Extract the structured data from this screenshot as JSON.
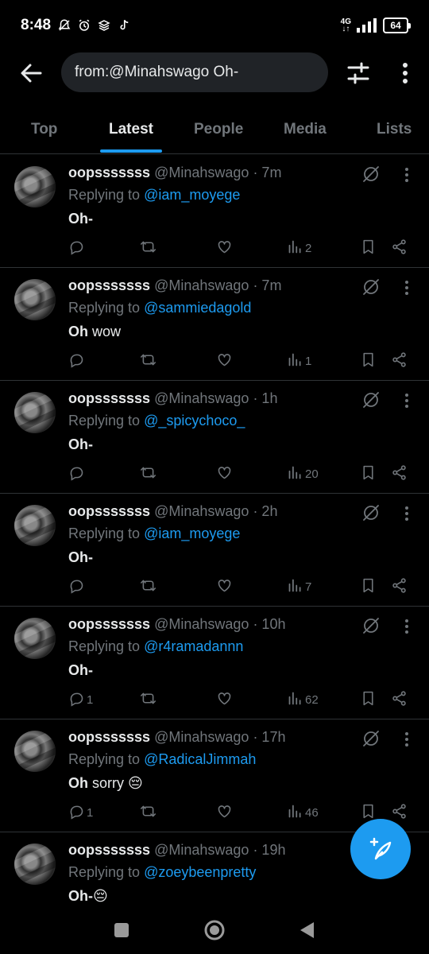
{
  "status": {
    "time": "8:48",
    "network": "4G",
    "battery": "64"
  },
  "search": {
    "query": "from:@Minahswago Oh-"
  },
  "tabs": [
    {
      "label": "Top"
    },
    {
      "label": "Latest"
    },
    {
      "label": "People"
    },
    {
      "label": "Media"
    },
    {
      "label": "Lists"
    }
  ],
  "tweets": [
    {
      "name": "oopsssssss",
      "handle": "@Minahswago",
      "time": "· 7m",
      "replying_prefix": "Replying to",
      "replying_to": "@iam_moyege",
      "text_bold": "Oh-",
      "text_rest": "",
      "replies": "",
      "views": "2"
    },
    {
      "name": "oopsssssss",
      "handle": "@Minahswago",
      "time": "· 7m",
      "replying_prefix": "Replying to",
      "replying_to": "@sammiedagold",
      "text_bold": "Oh",
      "text_rest": " wow",
      "replies": "",
      "views": "1"
    },
    {
      "name": "oopsssssss",
      "handle": "@Minahswago",
      "time": "· 1h",
      "replying_prefix": "Replying to",
      "replying_to": "@_spicychoco_",
      "text_bold": "Oh-",
      "text_rest": "",
      "replies": "",
      "views": "20"
    },
    {
      "name": "oopsssssss",
      "handle": "@Minahswago",
      "time": "· 2h",
      "replying_prefix": "Replying to",
      "replying_to": "@iam_moyege",
      "text_bold": "Oh-",
      "text_rest": "",
      "replies": "",
      "views": "7"
    },
    {
      "name": "oopsssssss",
      "handle": "@Minahswago",
      "time": "· 10h",
      "replying_prefix": "Replying to",
      "replying_to": "@r4ramadannn",
      "text_bold": "Oh-",
      "text_rest": "",
      "replies": "1",
      "views": "62"
    },
    {
      "name": "oopsssssss",
      "handle": "@Minahswago",
      "time": "· 17h",
      "replying_prefix": "Replying to",
      "replying_to": "@RadicalJimmah",
      "text_bold": "Oh",
      "text_rest": " sorry 😔",
      "replies": "1",
      "views": "46"
    },
    {
      "name": "oopsssssss",
      "handle": "@Minahswago",
      "time": "· 19h",
      "replying_prefix": "Replying to",
      "replying_to": "@zoeybeenpretty",
      "text_bold": "Oh-",
      "text_rest": "😔",
      "replies": "",
      "views": ""
    }
  ],
  "colors": {
    "accent": "#1d9bf0",
    "muted": "#71767b",
    "background": "#000000"
  },
  "icons": [
    "back-arrow-icon",
    "filter-icon",
    "more-vertical-icon",
    "grok-icon",
    "reply-icon",
    "retweet-icon",
    "like-icon",
    "views-icon",
    "bookmark-icon",
    "share-icon",
    "compose-icon"
  ]
}
